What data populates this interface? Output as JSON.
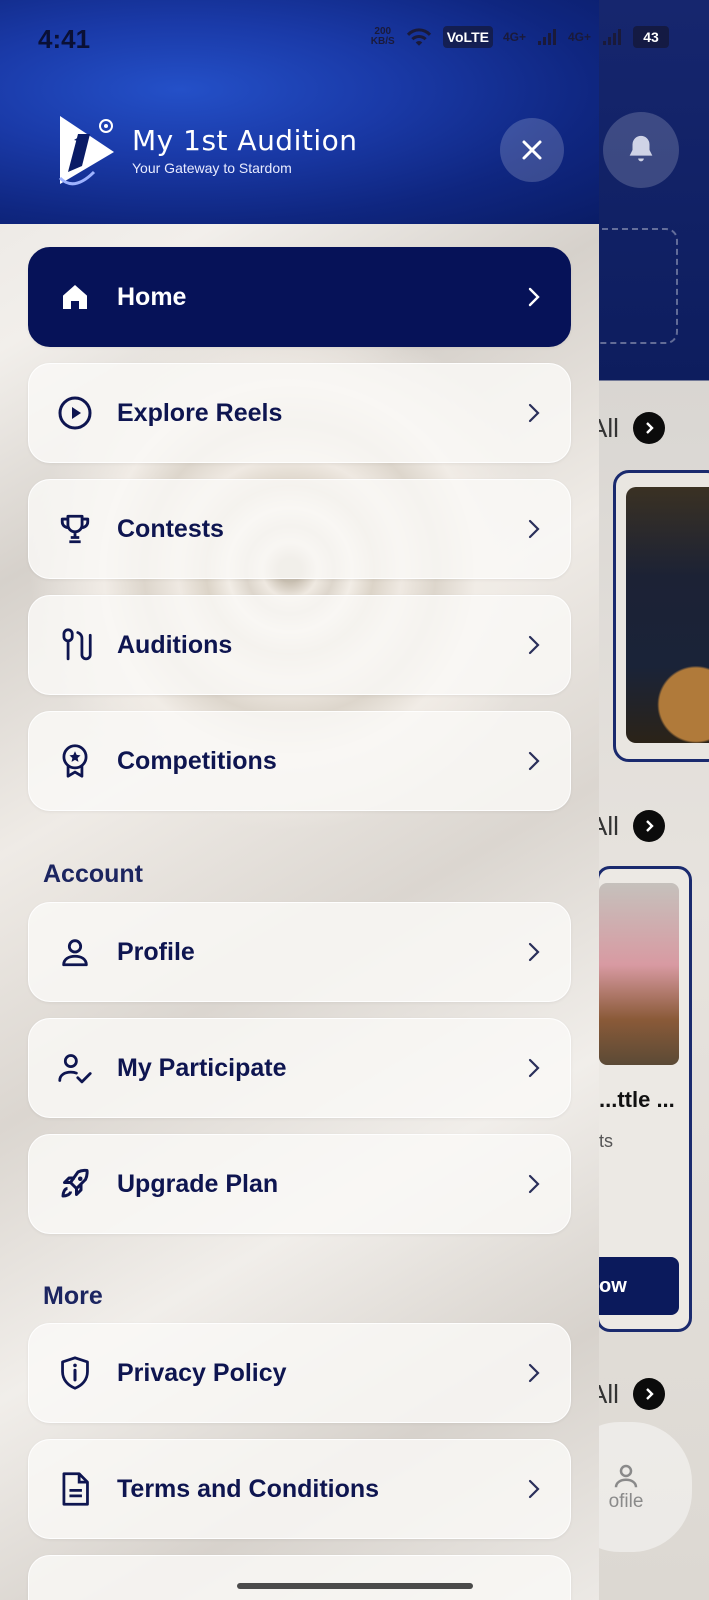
{
  "status_bar": {
    "time": "4:41",
    "speed": "200\nKB/S",
    "sim1": "4G+",
    "sim2": "4G+",
    "battery": "43"
  },
  "brand": {
    "name": "My 1st Audition",
    "tagline": "Your Gateway to Stardom"
  },
  "menu": {
    "main": [
      {
        "label": "Home",
        "icon": "home-icon"
      },
      {
        "label": "Explore Reels",
        "icon": "play-circle-icon"
      },
      {
        "label": "Contests",
        "icon": "trophy-icon"
      },
      {
        "label": "Auditions",
        "icon": "microphone-icon"
      },
      {
        "label": "Competitions",
        "icon": "award-badge-icon"
      }
    ],
    "account_title": "Account",
    "account": [
      {
        "label": "Profile",
        "icon": "user-icon"
      },
      {
        "label": "My Participate",
        "icon": "user-check-icon"
      },
      {
        "label": "Upgrade Plan",
        "icon": "rocket-icon"
      }
    ],
    "more_title": "More",
    "more": [
      {
        "label": "Privacy Policy",
        "icon": "shield-info-icon"
      },
      {
        "label": "Terms and Conditions",
        "icon": "document-icon"
      }
    ]
  },
  "background": {
    "view_all_1": "All",
    "view_all_2": "All",
    "view_all_3": "All",
    "card_title": "...ttle ...",
    "card_sub": "ts",
    "card_button": "ow",
    "nav_profile": "ofile"
  },
  "colors": {
    "accent": "#061258",
    "header_blue": "#1a3aa8"
  }
}
